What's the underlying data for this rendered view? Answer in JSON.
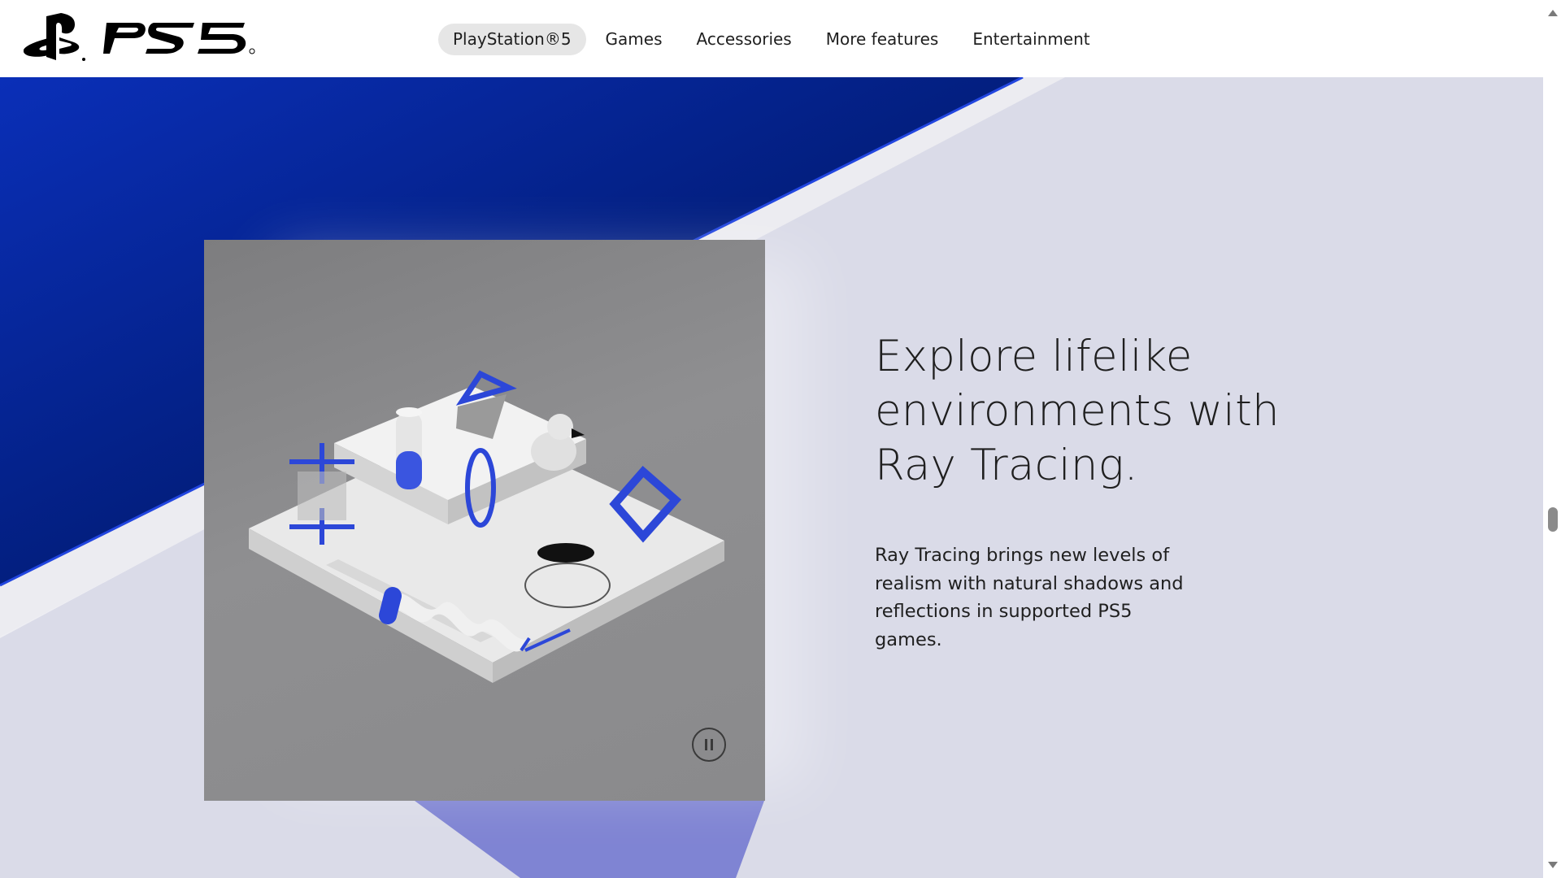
{
  "brand": {
    "logo_text": "PS5"
  },
  "nav": {
    "items": [
      {
        "label": "PlayStation®5",
        "active": true
      },
      {
        "label": "Games",
        "active": false
      },
      {
        "label": "Accessories",
        "active": false
      },
      {
        "label": "More features",
        "active": false
      },
      {
        "label": "Entertainment",
        "active": false
      }
    ]
  },
  "feature": {
    "headline_line1": "Explore lifelike",
    "headline_line2": "environments with",
    "headline_line3": "Ray Tracing.",
    "description": "Ray Tracing brings new levels of realism with natural shadows and reflections in supported PS5 games."
  },
  "media": {
    "control_icon": "pause-icon"
  },
  "colors": {
    "accent_blue": "#0a2ec2",
    "deep_blue": "#021a6e",
    "background": "#dadbe8"
  }
}
